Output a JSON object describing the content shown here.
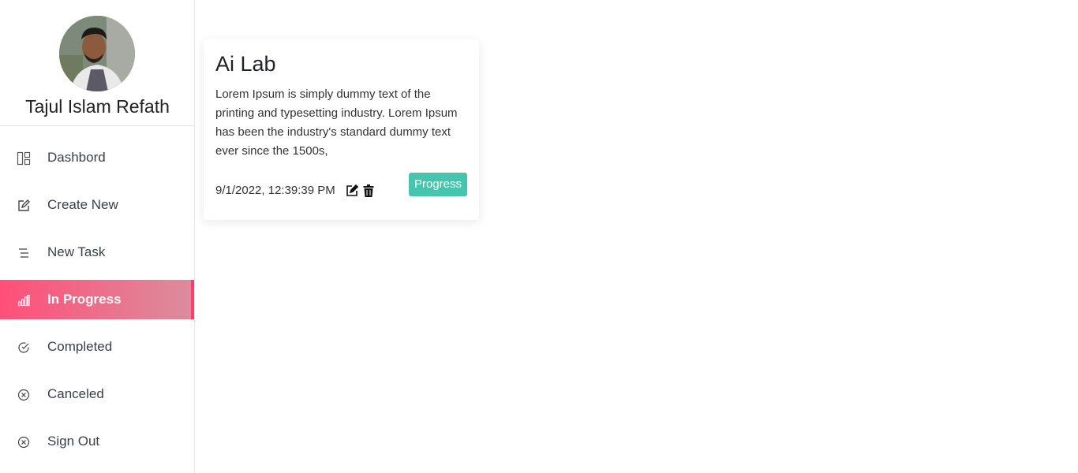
{
  "profile": {
    "name": "Tajul Islam Refath"
  },
  "sidebar": {
    "items": [
      {
        "label": "Dashbord",
        "icon": "dashboard-icon",
        "active": false
      },
      {
        "label": "Create New",
        "icon": "edit-icon",
        "active": false
      },
      {
        "label": "New Task",
        "icon": "list-icon",
        "active": false
      },
      {
        "label": "In Progress",
        "icon": "bar-chart-icon",
        "active": true
      },
      {
        "label": "Completed",
        "icon": "check-circle-icon",
        "active": false
      },
      {
        "label": "Canceled",
        "icon": "x-circle-icon",
        "active": false
      },
      {
        "label": "Sign Out",
        "icon": "x-circle-icon",
        "active": false
      }
    ]
  },
  "task": {
    "title": "Ai Lab",
    "description": "Lorem Ipsum is simply dummy text of the printing and typesetting industry. Lorem Ipsum has been the industry's standard dummy text ever since the 1500s,",
    "date": "9/1/2022, 12:39:39 PM",
    "status": "Progress"
  },
  "colors": {
    "active_gradient_start": "#ff4f78",
    "active_gradient_end": "#db8c9c",
    "status_badge": "#45c4ae"
  }
}
